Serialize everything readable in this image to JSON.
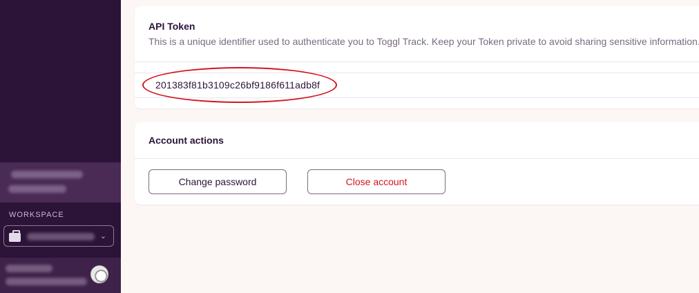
{
  "sidebar": {
    "workspace_label": "WORKSPACE",
    "workspace_select_chevron": "chevron-down-icon"
  },
  "api_token": {
    "title": "API Token",
    "description": "This is a unique identifier used to authenticate you to Toggl Track. Keep your Token private to avoid sharing sensitive information.",
    "value": "201383f81b3109c26bf9186f611adb8f"
  },
  "account_actions": {
    "title": "Account actions",
    "change_password_label": "Change password",
    "close_account_label": "Close account"
  },
  "colors": {
    "sidebar_bg": "#2c1338",
    "danger": "#d3151e",
    "annotation": "#d3151e"
  }
}
